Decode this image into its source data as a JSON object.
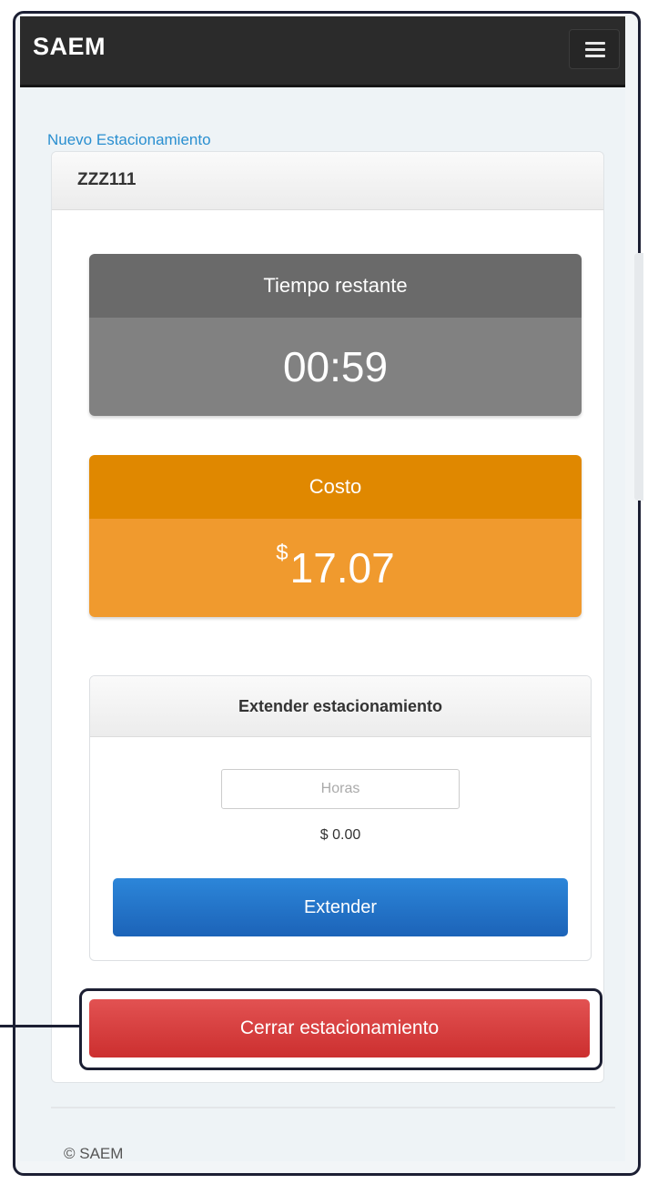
{
  "app": {
    "brand": "SAEM",
    "menu_icon": "hamburger-menu-icon"
  },
  "breadcrumb": {
    "link": "Nuevo Estacionamiento"
  },
  "parking": {
    "plate": "ZZZ111",
    "remaining": {
      "label": "Tiempo restante",
      "value": "00:59"
    },
    "cost": {
      "label": "Costo",
      "currency": "$",
      "value": "17.07"
    }
  },
  "extend": {
    "title": "Extender estacionamiento",
    "hours_placeholder": "Horas",
    "hours_value": "",
    "cost_text": "$ 0.00",
    "button_label": "Extender"
  },
  "close_button_label": "Cerrar estacionamiento",
  "footer": {
    "text": "© SAEM"
  },
  "colors": {
    "navbar": "#2b2b2b",
    "link": "#2a8fd0",
    "time_card": "#818181",
    "cost_card": "#f09a2e",
    "extend_button": "#1c63b8",
    "close_button": "#cc2f2f",
    "annotation": "#1c1f33"
  }
}
